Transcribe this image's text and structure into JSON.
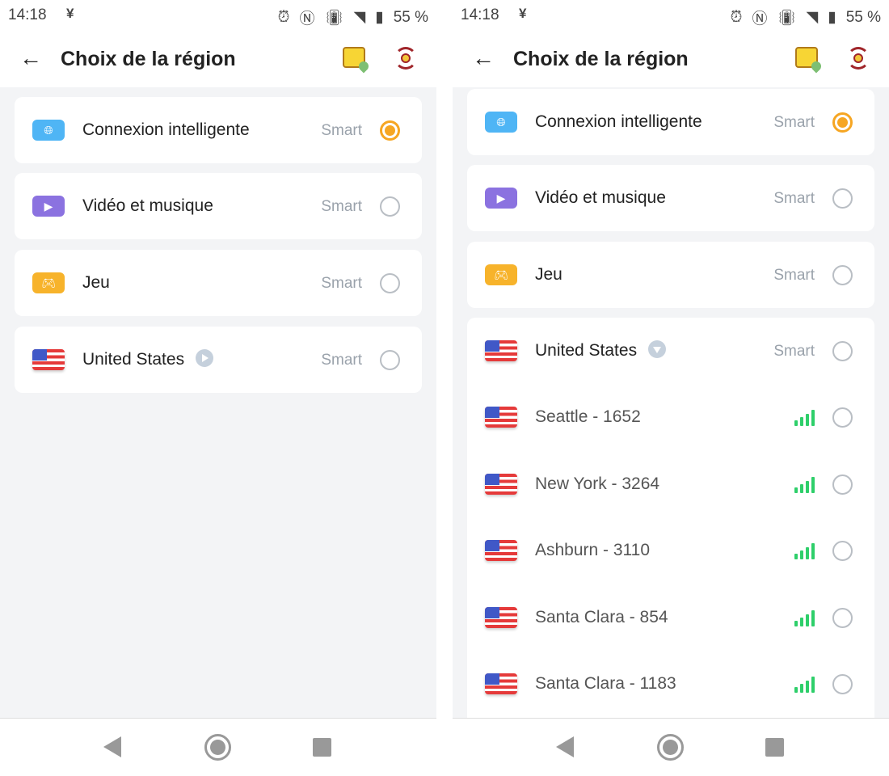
{
  "status_bar": {
    "time": "14:18",
    "battery": "55 %"
  },
  "header": {
    "title": "Choix de la région"
  },
  "colors": {
    "accent": "#f6a623",
    "signal": "#2ecf6a"
  },
  "panels": [
    {
      "rows": [
        {
          "label": "Connexion intelligente",
          "icon": "globe-icon",
          "icon_color": "#4fb5f5",
          "tag": "Smart",
          "selected": true
        },
        {
          "label": "Vidéo et musique",
          "icon": "play-icon",
          "icon_color": "#8b72e0",
          "tag": "Smart",
          "selected": false
        },
        {
          "label": "Jeu",
          "icon": "gamepad-icon",
          "icon_color": "#f7b32b",
          "tag": "Smart",
          "selected": false
        },
        {
          "label": "United States",
          "icon": "us-flag-icon",
          "tag": "Smart",
          "selected": false,
          "expand": "collapsed"
        }
      ]
    },
    {
      "rows": [
        {
          "label": "Connexion intelligente",
          "icon": "globe-icon",
          "icon_color": "#4fb5f5",
          "tag": "Smart",
          "selected": true
        },
        {
          "label": "Vidéo et musique",
          "icon": "play-icon",
          "icon_color": "#8b72e0",
          "tag": "Smart",
          "selected": false
        },
        {
          "label": "Jeu",
          "icon": "gamepad-icon",
          "icon_color": "#f7b32b",
          "tag": "Smart",
          "selected": false
        },
        {
          "label": "United States",
          "icon": "us-flag-icon",
          "tag": "Smart",
          "selected": false,
          "expand": "expanded",
          "servers": [
            {
              "label": "Seattle - 1652",
              "signal_bars": 4
            },
            {
              "label": "New York - 3264",
              "signal_bars": 4
            },
            {
              "label": "Ashburn - 3110",
              "signal_bars": 4
            },
            {
              "label": "Santa Clara - 854",
              "signal_bars": 4
            },
            {
              "label": "Santa Clara - 1183",
              "signal_bars": 4
            }
          ]
        }
      ]
    }
  ]
}
